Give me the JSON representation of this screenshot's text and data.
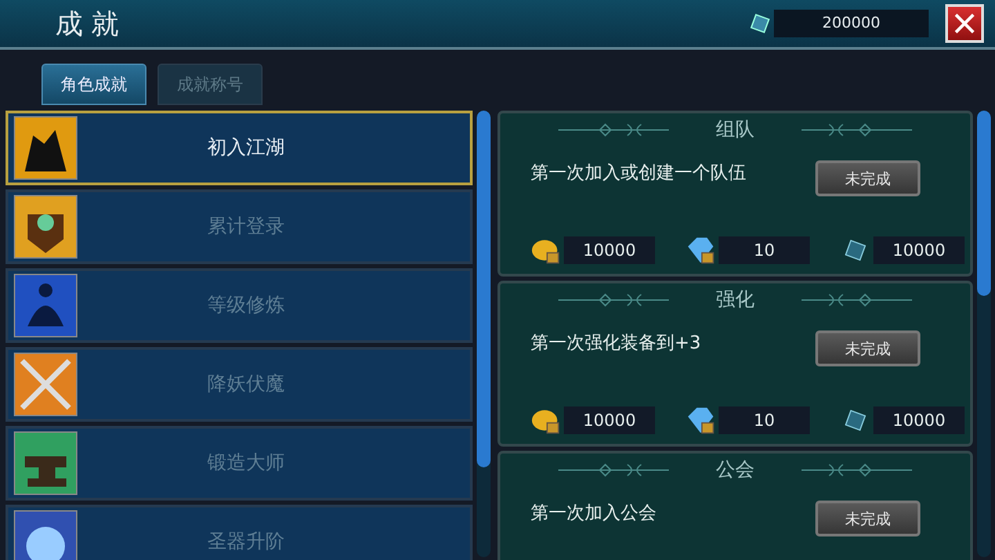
{
  "window": {
    "title": "成就",
    "currency": "200000"
  },
  "tabs": [
    {
      "label": "角色成就",
      "selected": true
    },
    {
      "label": "成就称号",
      "selected": false
    }
  ],
  "achievement_list": [
    {
      "label": "初入江湖",
      "selected": true
    },
    {
      "label": "累计登录",
      "selected": false
    },
    {
      "label": "等级修炼",
      "selected": false
    },
    {
      "label": "降妖伏魔",
      "selected": false
    },
    {
      "label": "锻造大师",
      "selected": false
    },
    {
      "label": "圣器升阶",
      "selected": false
    }
  ],
  "tasks": [
    {
      "title": "组队",
      "description": "第一次加入或创建一个队伍",
      "status": "未完成",
      "rewards": [
        {
          "kind": "gold",
          "amount": "10000"
        },
        {
          "kind": "diamond",
          "amount": "10"
        },
        {
          "kind": "gem",
          "amount": "10000"
        }
      ]
    },
    {
      "title": "强化",
      "description": "第一次强化装备到+3",
      "status": "未完成",
      "rewards": [
        {
          "kind": "gold",
          "amount": "10000"
        },
        {
          "kind": "diamond",
          "amount": "10"
        },
        {
          "kind": "gem",
          "amount": "10000"
        }
      ]
    },
    {
      "title": "公会",
      "description": "第一次加入公会",
      "status": "未完成"
    }
  ]
}
